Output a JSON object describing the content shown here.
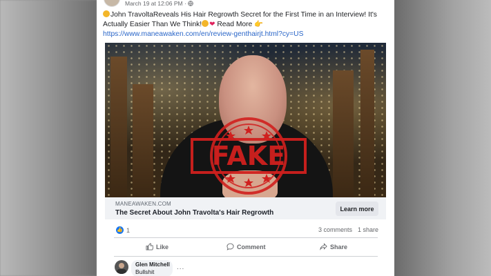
{
  "post": {
    "meta": "March 19 at 12:06 PM · ",
    "text_before_link": "John TravoltaReveals His Hair Regrowth Secret for the First Time in an Interview! It's Actually Easier Than We Think!",
    "read_more": " Read More ",
    "link": "https://www.maneawaken.com/en/review-genthairjt.html?cy=US"
  },
  "media": {
    "stamp_text": "FAKE",
    "stamp_color": "#d0201e",
    "icon": "video-frame"
  },
  "link_preview": {
    "domain": "MANEAWAKEN.COM",
    "title": "The Secret About John Travolta's Hair Regrowth",
    "button": "Learn more"
  },
  "stats": {
    "likes": "1",
    "comments": "3 comments",
    "shares": "1 share"
  },
  "actions": {
    "like": "Like",
    "comment": "Comment",
    "share": "Share"
  },
  "comment": {
    "author": "Glen Mitchell",
    "text": "Bullshit",
    "more": "..."
  }
}
